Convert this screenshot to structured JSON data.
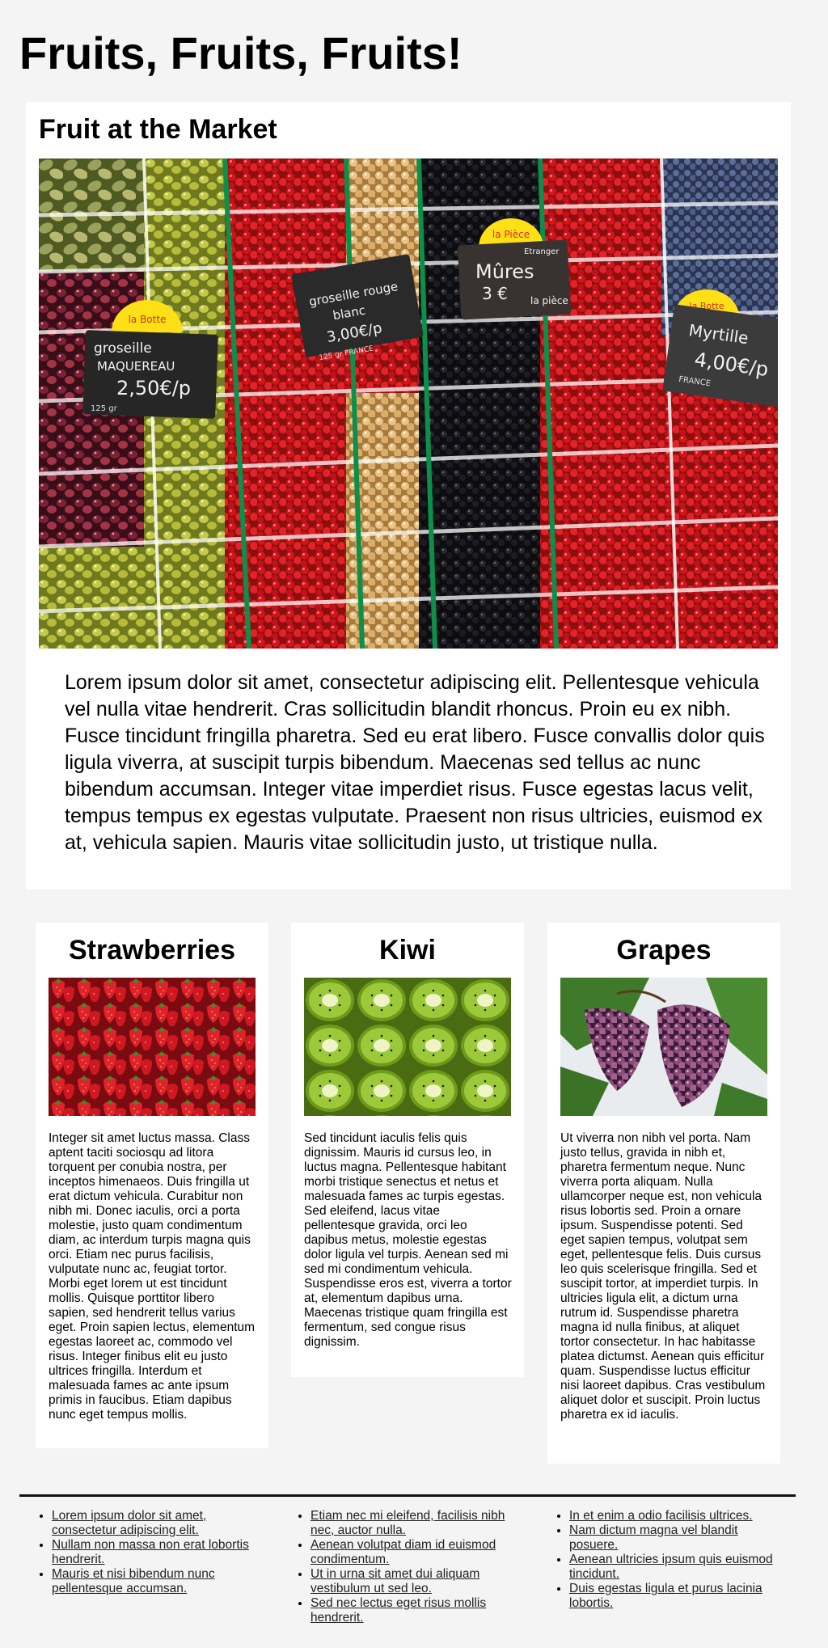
{
  "page": {
    "title": "Fruits, Fruits, Fruits!"
  },
  "market": {
    "heading": "Fruit at the Market",
    "image_alt": "Fruit market stall with berries, currants and grapes in punnets",
    "signs": [
      {
        "tag": "la Botte",
        "lines": [
          "groseille",
          "MAQUEREAU",
          "2,50€/p"
        ],
        "small": "125 gr"
      },
      {
        "tag": "",
        "lines": [
          "groseille rouge",
          "blanc",
          "3,00€/p"
        ],
        "small": "125 gr  FRANCE"
      },
      {
        "tag": "la Pièce",
        "lines": [
          "Mûres",
          "3 €",
          "la pièce"
        ],
        "small": "Etranger"
      },
      {
        "tag": "la Botte",
        "lines": [
          "Myrtille",
          "4,00€/p"
        ],
        "small": "FRANCE"
      }
    ],
    "text": "Lorem ipsum dolor sit amet, consectetur adipiscing elit. Pellentesque vehicula vel nulla vitae hendrerit. Cras sollicitudin blandit rhoncus. Proin eu ex nibh. Fusce tincidunt fringilla pharetra. Sed eu erat libero. Fusce convallis dolor quis ligula viverra, at suscipit turpis bibendum. Maecenas sed tellus ac nunc bibendum accumsan. Integer vitae imperdiet risus. Fusce egestas lacus velit, tempus tempus ex egestas vulputate. Praesent non risus ultricies, euismod ex at, vehicula sapien. Mauris vitae sollicitudin justo, ut tristique nulla."
  },
  "fruits": [
    {
      "name": "Strawberries",
      "image_alt": "Pile of strawberries",
      "text": "Integer sit amet luctus massa. Class aptent taciti sociosqu ad litora torquent per conubia nostra, per inceptos himenaeos. Duis fringilla ut erat dictum vehicula. Curabitur non nibh mi. Donec iaculis, orci a porta molestie, justo quam condimentum diam, ac interdum turpis magna quis orci. Etiam nec purus facilisis, vulputate nunc ac, feugiat tortor. Morbi eget lorem ut est tincidunt mollis. Quisque porttitor libero sapien, sed hendrerit tellus varius eget. Proin sapien lectus, elementum egestas laoreet ac, commodo vel risus. Integer finibus elit eu justo ultrices fringilla. Interdum et malesuada fames ac ante ipsum primis in faucibus. Etiam dapibus nunc eget tempus mollis."
    },
    {
      "name": "Kiwi",
      "image_alt": "Kiwi fruit slices",
      "text": "Sed tincidunt iaculis felis quis dignissim. Mauris id cursus leo, in luctus magna. Pellentesque habitant morbi tristique senectus et netus et malesuada fames ac turpis egestas. Sed eleifend, lacus vitae pellentesque gravida, orci leo dapibus metus, molestie egestas dolor ligula vel turpis. Aenean sed mi sed mi condimentum vehicula. Suspendisse eros est, viverra a tortor at, elementum dapibus urna. Maecenas tristique quam fringilla est fermentum, sed congue risus dignissim."
    },
    {
      "name": "Grapes",
      "image_alt": "Bunches of red grapes with leaves",
      "text": "Ut viverra non nibh vel porta. Nam justo tellus, gravida in nibh et, pharetra fermentum neque. Nunc viverra porta aliquam. Nulla ullamcorper neque est, non vehicula risus lobortis sed. Proin a ornare ipsum. Suspendisse potenti. Sed eget sapien tempus, volutpat sem eget, pellentesque felis. Duis cursus leo quis scelerisque fringilla. Sed et suscipit tortor, at imperdiet turpis. In ultricies ligula elit, a dictum urna rutrum id. Suspendisse pharetra magna id nulla finibus, at aliquet tortor consectetur. In hac habitasse platea dictumst. Aenean quis efficitur quam. Suspendisse luctus efficitur nisi laoreet dapibus. Cras vestibulum aliquet dolor et suscipit. Proin luctus pharetra ex id iaculis."
    }
  ],
  "footer": {
    "columns": [
      [
        "Lorem ipsum dolor sit amet, consectetur adipiscing elit.",
        "Nullam non massa non erat lobortis hendrerit.",
        "Mauris et nisi bibendum nunc pellentesque accumsan."
      ],
      [
        "Etiam nec mi eleifend, facilisis nibh nec, auctor nulla.",
        "Aenean volutpat diam id euismod condimentum.",
        "Ut in urna sit amet dui aliquam vestibulum ut sed leo.",
        "Sed nec lectus eget risus mollis hendrerit."
      ],
      [
        "In et enim a odio facilisis ultrices.",
        "Nam dictum magna vel blandit posuere.",
        "Aenean ultricies ipsum quis euismod tincidunt.",
        "Duis egestas ligula et purus lacinia lobortis."
      ]
    ]
  }
}
